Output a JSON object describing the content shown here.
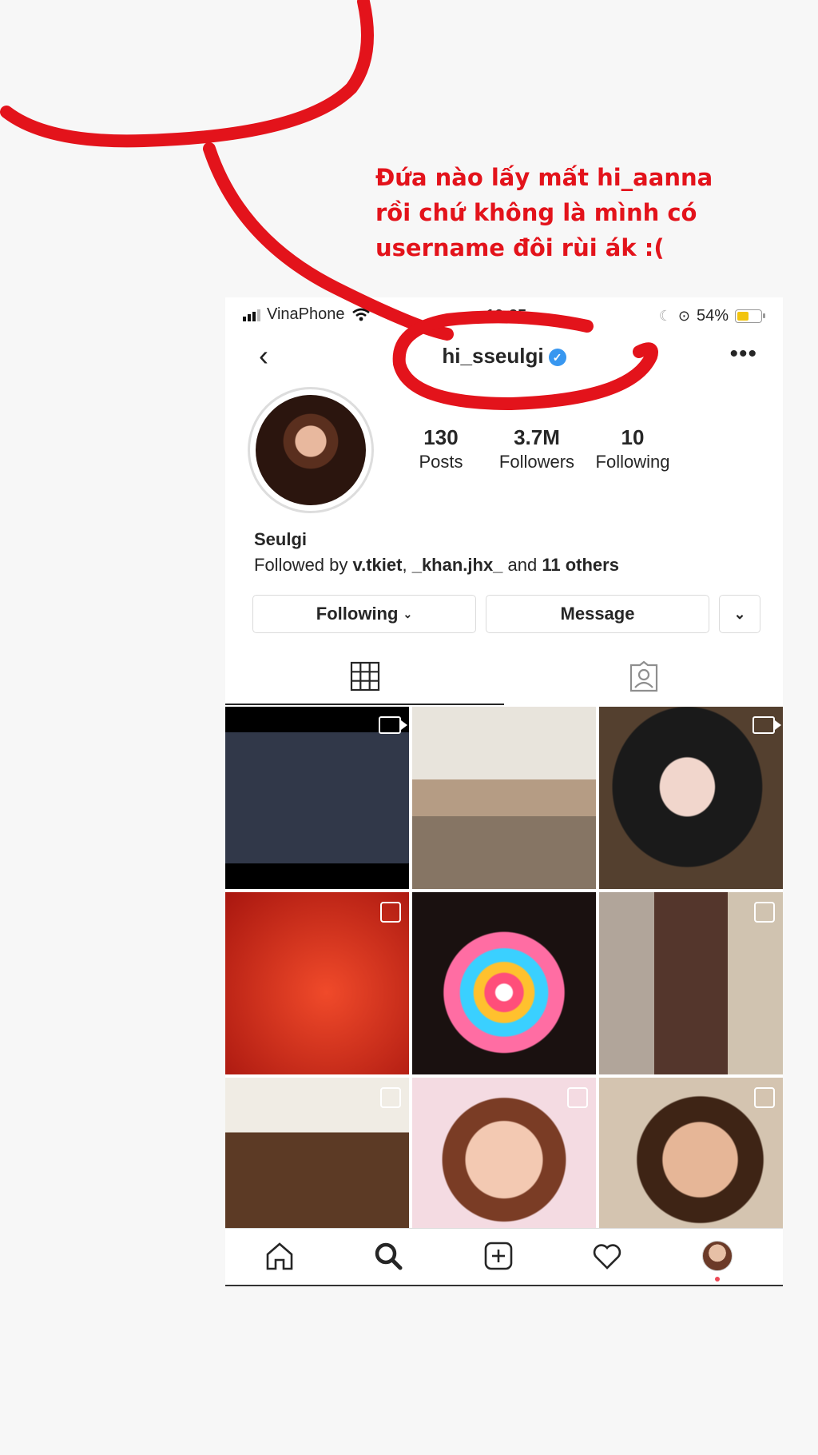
{
  "caption": {
    "lines": [
      "Đứa nào lấy mất hi_aanna",
      "rồi chứ không là mình có",
      "username đôi rùi ák :("
    ],
    "color": "#e3131b"
  },
  "status_bar": {
    "carrier": "VinaPhone",
    "time": "10:25",
    "battery": "54%"
  },
  "profile": {
    "username": "hi_sseulgi",
    "verified_icon": "verified-badge-icon",
    "stats": [
      {
        "value": "130",
        "label": "Posts"
      },
      {
        "value": "3.7M",
        "label": "Followers"
      },
      {
        "value": "10",
        "label": "Following"
      }
    ],
    "display_name": "Seulgi",
    "followed_by": {
      "prefix": "Followed by ",
      "user1": "v.tkiet",
      "sep": ", ",
      "user2": "_khan.jhx_",
      "and": " and ",
      "others": "11 others"
    }
  },
  "buttons": {
    "following": "Following",
    "message": "Message"
  },
  "tabs": [
    "grid-tab",
    "tagged-tab"
  ],
  "posts": [
    {
      "type": "video"
    },
    {
      "type": "photo"
    },
    {
      "type": "video"
    },
    {
      "type": "carousel"
    },
    {
      "type": "photo"
    },
    {
      "type": "carousel"
    },
    {
      "type": "carousel"
    },
    {
      "type": "carousel"
    },
    {
      "type": "carousel"
    }
  ],
  "bottom_nav": [
    "home-icon",
    "search-icon",
    "new-post-icon",
    "activity-heart-icon",
    "profile-avatar"
  ],
  "colors": {
    "accent_verified": "#3897f0",
    "annotation_red": "#e3131b",
    "notification_dot": "#ed4956"
  }
}
